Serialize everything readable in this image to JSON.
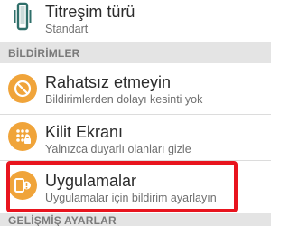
{
  "vibration_type": {
    "title": "Titreşim türü",
    "value": "Standart",
    "icon": "phone-vibrate-icon"
  },
  "notifications_section": {
    "header": "BİLDİRİMLER",
    "items": [
      {
        "title": "Rahatsız etmeyin",
        "subtitle": "Bildirimlerden dolayı kesinti yok",
        "icon": "do-not-disturb-icon"
      },
      {
        "title": "Kilit Ekranı",
        "subtitle": "Yalnızca duyarlı olanları gizle",
        "icon": "lock-screen-icon"
      },
      {
        "title": "Uygulamalar",
        "subtitle": "Uygulamalar için bildirim ayarlayın",
        "icon": "app-notifications-icon",
        "highlighted": true
      }
    ]
  },
  "advanced_section": {
    "header": "GELİŞMİŞ AYARLAR"
  },
  "colors": {
    "icon_accent": "#f0a43a",
    "highlight": "#e8141e",
    "section_header_bg": "#e4e4e4"
  }
}
